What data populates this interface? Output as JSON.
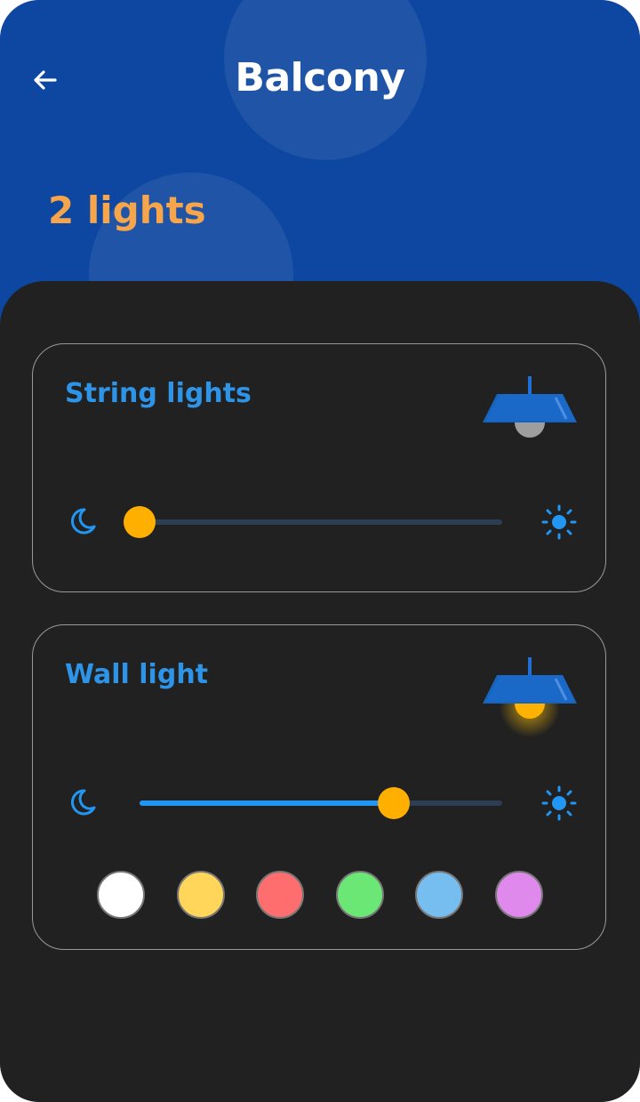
{
  "header": {
    "title": "Balcony",
    "subtitle": "2 lights",
    "back_icon": "arrow-left-icon"
  },
  "colors": {
    "header_bg": "#0e47a1",
    "sheet_bg": "#212121",
    "accent": "#2196f3",
    "label": "#2e94e8",
    "count": "#f6a54b",
    "thumb": "#ffaf00"
  },
  "lights": [
    {
      "name": "String lights",
      "on": false,
      "brightness": 0.0,
      "icons": {
        "min": "moon-icon",
        "max": "sun-icon",
        "lamp": "pendant-lamp-icon"
      }
    },
    {
      "name": "Wall light",
      "on": true,
      "brightness": 0.7,
      "icons": {
        "min": "moon-icon",
        "max": "sun-icon",
        "lamp": "pendant-lamp-icon"
      },
      "color_options": [
        "#ffffff",
        "#ffd55a",
        "#ff6e6e",
        "#6be776",
        "#76bdf0",
        "#df89ed"
      ]
    }
  ]
}
